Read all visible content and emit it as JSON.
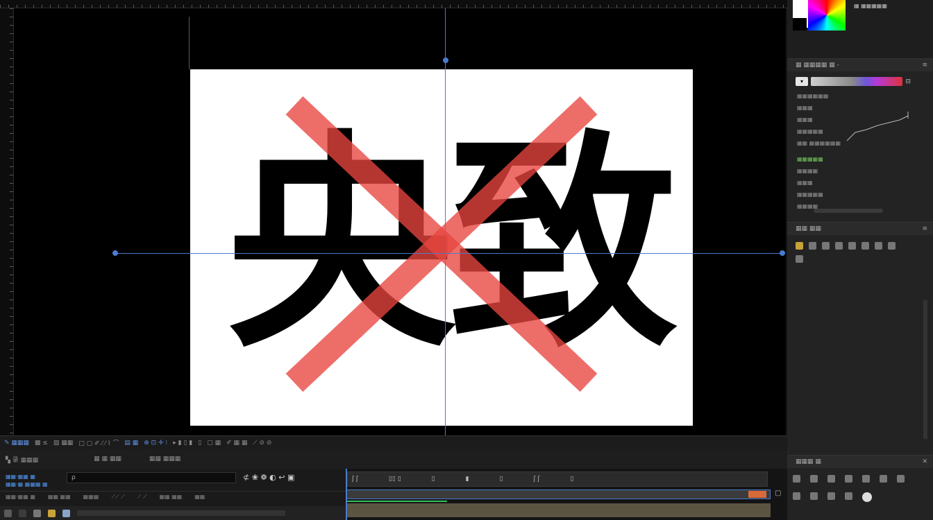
{
  "canvas": {
    "left_glyph": "央",
    "right_glyph": "致",
    "accent": "#4a7bd0",
    "cross_color": "#e8453f"
  },
  "toolbar": {
    "items": [
      "✎ ▦▦▦",
      "▩ ≤",
      "▨ ▦▦",
      "□ ▢ ✐ ⁄ ⁄ ⌇ ⌒",
      "▤ ▦",
      "⊕ ⊡ ✛ ⁝",
      "▸ ▮ ▯ ▮",
      "▯",
      "▢ ▦",
      "✐ ▦ ▦",
      "⟋ ⊘ ⊘"
    ]
  },
  "timeline": {
    "header_items": [
      "▚ 录 ▦▦▦",
      "▦ ▦ ▦▦",
      "▦▦ ▦▦▦"
    ],
    "search_value": "ρ",
    "left_labels": [
      "▦▦·▦▦ ▦",
      "▦▦·▦ ▦▦▦ ▦"
    ],
    "col_labels": [
      "▦▦·▦▦ ▦",
      "▦▦ ▦▦",
      "▦▦▦",
      "⟋⟋ ⟋",
      "⟋ ⟋",
      "▦▦ ▦▦",
      "▦▦"
    ],
    "track_marks": [
      "ʃ ʃ",
      "▯▯ ▯",
      "▯",
      "▮",
      "▯",
      "ʃ ʃ",
      "▯"
    ]
  },
  "right_panel": {
    "swatches_label": "▦ ▦▦▦▦▦",
    "adjust_title": "▦ ▦▦▦▦ ▦ -",
    "adjust_rows": [
      "▦▦▦▦▦▦",
      "▦▦▦",
      "▦▦▦",
      "▦▦▦▦▦",
      "▦▦ ▦▦▦▦▦▦"
    ],
    "adjust_rows2": [
      "▦▦▦▦▦",
      "▦▦▦▦",
      "▦▦▦",
      "▦▦▦▦▦",
      "▦▦▦▦"
    ],
    "props_title": "▦▦ ▦▦",
    "bottom_title": "▦▦▦ ▦"
  }
}
